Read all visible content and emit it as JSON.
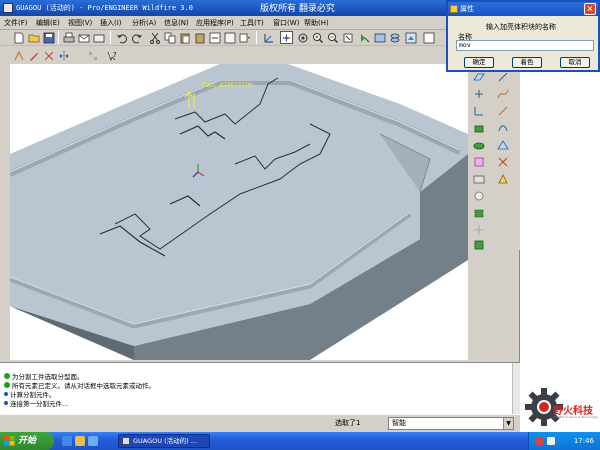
{
  "window": {
    "title": "GUAGOU (活动的) - Pro/ENGINEER Wildfire 3.0",
    "watermark": "版权所有  翻录必究"
  },
  "menu": [
    "文件(F)",
    "编辑(E)",
    "视图(V)",
    "插入(I)",
    "分析(A)",
    "信息(N)",
    "应用程序(P)",
    "工具(T)",
    "窗口(W)",
    "帮助(H)"
  ],
  "model": {
    "annotation_label": "PULL_DIRECTION",
    "axis_colors": {
      "x": "#e03030",
      "y": "#20a020",
      "z": "#2020e0"
    },
    "body_color": "#b9c6d1",
    "pull_arrow_color": "#e8e84a"
  },
  "messages": [
    "为分割工件选取分型面。",
    "所有元素已定义。请从对话框中选取元素或动作。",
    "计算分割元件。",
    "连接第一分割元件..."
  ],
  "status": {
    "selection": "选取了1",
    "filter": "智能"
  },
  "dialog": {
    "title": "属性",
    "prompt": "输入加亮体积块的名称",
    "name_label": "名称",
    "name_value": "mov",
    "ok": "确定",
    "shade": "着色",
    "cancel": "取消"
  },
  "logo": {
    "text": "野火科技",
    "tagline": "Wildfire Science & Technology",
    "color": "#d4261c"
  },
  "taskbar": {
    "start": "开始",
    "task": "GUAGOU (活动的) ...",
    "clock": "17:46"
  }
}
